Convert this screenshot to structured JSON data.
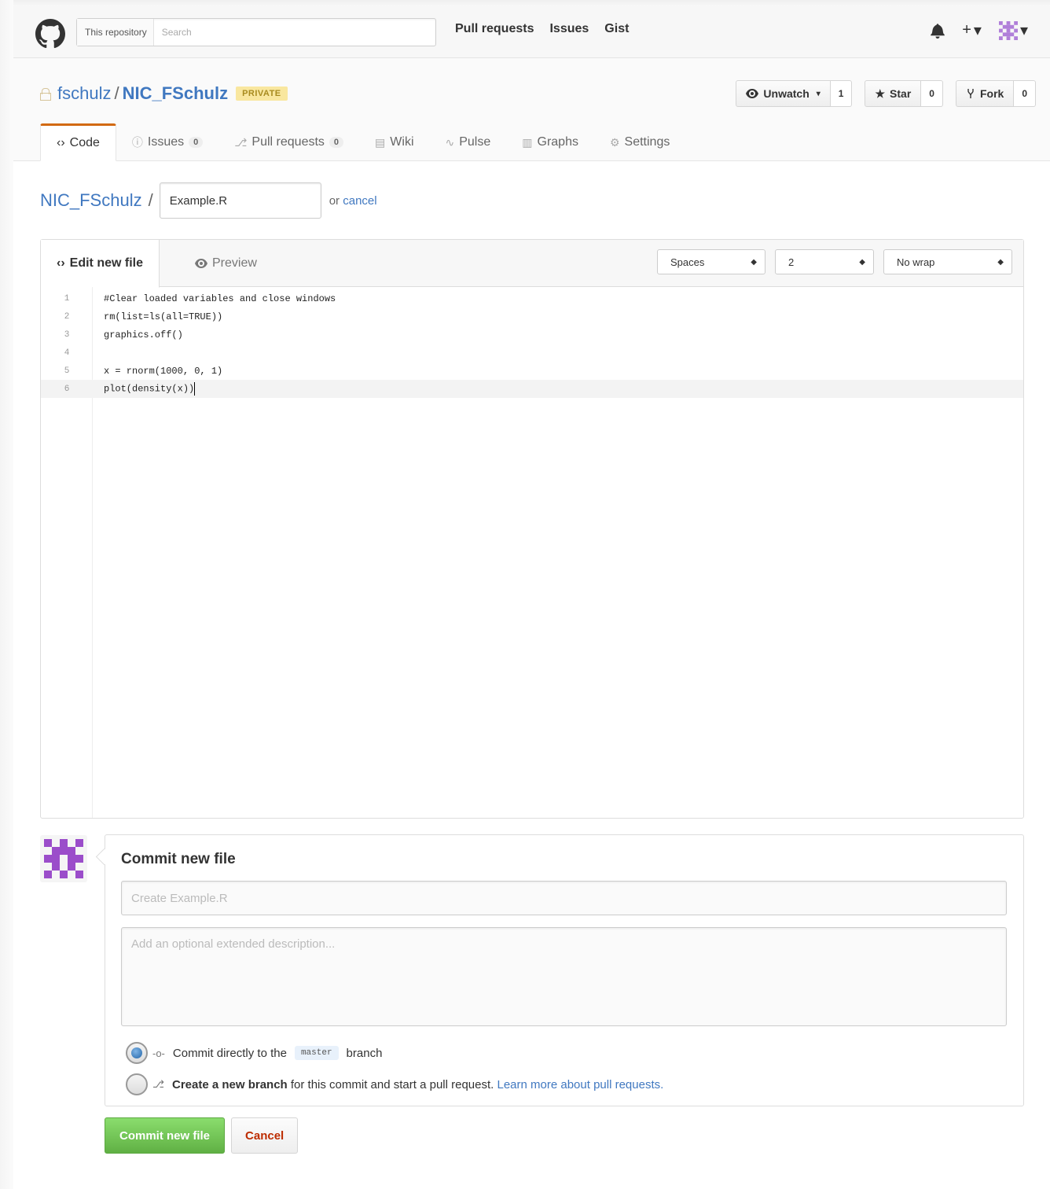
{
  "header": {
    "search_scope": "This repository",
    "search_placeholder": "Search",
    "nav": [
      "Pull requests",
      "Issues",
      "Gist"
    ],
    "icons": [
      "octocat-logo",
      "bell-icon",
      "plus-icon",
      "avatar-identicon"
    ]
  },
  "repo": {
    "owner": "fschulz",
    "name": "NIC_FSchulz",
    "visibility_badge": "PRIVATE",
    "watch_label": "Unwatch",
    "watch_count": "1",
    "star_label": "Star",
    "star_count": "0",
    "fork_label": "Fork",
    "fork_count": "0"
  },
  "tabs": [
    {
      "label": "Code",
      "icon": "code-icon",
      "selected": true
    },
    {
      "label": "Issues",
      "count": "0",
      "icon": "issue-icon"
    },
    {
      "label": "Pull requests",
      "count": "0",
      "icon": "pull-request-icon"
    },
    {
      "label": "Wiki",
      "icon": "book-icon"
    },
    {
      "label": "Pulse",
      "icon": "pulse-icon"
    },
    {
      "label": "Graphs",
      "icon": "graph-icon"
    },
    {
      "label": "Settings",
      "icon": "gear-icon"
    }
  ],
  "breadcrumb": {
    "repo": "NIC_FSchulz",
    "separator": "/",
    "filename": "Example.R",
    "or_text": "or",
    "cancel_link": "cancel"
  },
  "editor": {
    "tab_edit": "Edit new file",
    "tab_preview": "Preview",
    "indent_mode": "Spaces",
    "indent_size": "2",
    "wrap_mode": "No wrap",
    "lines": [
      {
        "n": "1",
        "text": "#Clear loaded variables and close windows"
      },
      {
        "n": "2",
        "text": "rm(list=ls(all=TRUE))"
      },
      {
        "n": "3",
        "text": "graphics.off()"
      },
      {
        "n": "4",
        "text": ""
      },
      {
        "n": "5",
        "text": "x = rnorm(1000, 0, 1)"
      },
      {
        "n": "6",
        "text": "plot(density(x))"
      }
    ],
    "active_line": 6
  },
  "commit": {
    "title": "Commit new file",
    "summary_placeholder": "Create Example.R",
    "description_placeholder": "Add an optional extended description...",
    "option_direct_prefix": "Commit directly to the",
    "option_direct_branch": "master",
    "option_direct_suffix": "branch",
    "option_new_branch_bold": "Create a new branch",
    "option_new_branch_rest": "for this commit and start a pull request.",
    "option_new_branch_link": "Learn more about pull requests.",
    "selected_option": "direct",
    "submit_label": "Commit new file",
    "cancel_label": "Cancel"
  },
  "colors": {
    "link": "#4078c0",
    "accent_tab": "#d26911",
    "primary_button": "#60b044",
    "danger_text": "#bd2c00",
    "identicon": "#9b4dca"
  }
}
